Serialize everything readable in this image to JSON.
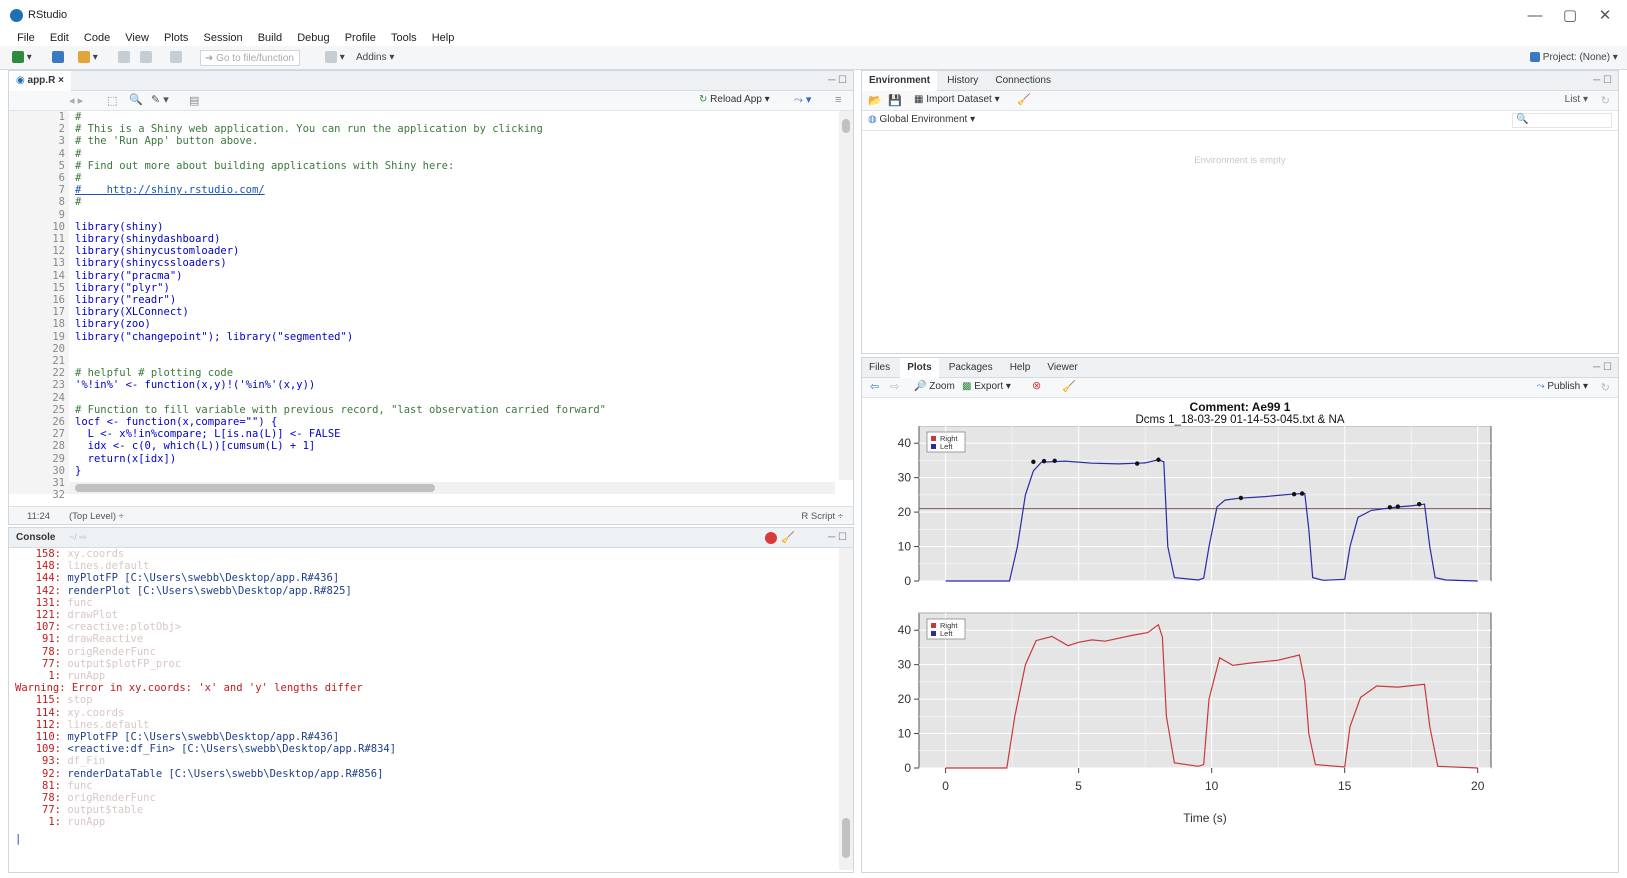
{
  "window": {
    "title": "RStudio",
    "minimize": "—",
    "maximize": "▢",
    "close": "✕"
  },
  "menu": [
    "File",
    "Edit",
    "Code",
    "View",
    "Plots",
    "Session",
    "Build",
    "Debug",
    "Profile",
    "Tools",
    "Help"
  ],
  "toolbar": {
    "goto_placeholder": "Go to file/function",
    "addins": "Addins ▾",
    "project": "Project: (None) ▾"
  },
  "editor": {
    "tab": "app.R",
    "reload_app": "Reload App ▾",
    "lines": [
      {
        "n": "1",
        "text": "#",
        "cls": "cm"
      },
      {
        "n": "2",
        "text": "# This is a Shiny web application. You can run the application by clicking",
        "cls": "cm"
      },
      {
        "n": "3",
        "text": "# the 'Run App' button above.",
        "cls": "cm"
      },
      {
        "n": "4",
        "text": "#",
        "cls": "cm"
      },
      {
        "n": "5",
        "text": "# Find out more about building applications with Shiny here:",
        "cls": "cm"
      },
      {
        "n": "6",
        "text": "#",
        "cls": "cm"
      },
      {
        "n": "7",
        "text": "#    http://shiny.rstudio.com/",
        "cls": "url"
      },
      {
        "n": "8",
        "text": "#",
        "cls": "cm"
      },
      {
        "n": "9",
        "text": "",
        "cls": ""
      },
      {
        "n": "10",
        "text": "library(shiny)",
        "cls": "kw"
      },
      {
        "n": "11",
        "text": "library(shinydashboard)",
        "cls": "kw"
      },
      {
        "n": "12",
        "text": "library(shinycustomloader)",
        "cls": "kw"
      },
      {
        "n": "13",
        "text": "library(shinycssloaders)",
        "cls": "kw"
      },
      {
        "n": "14",
        "text": "library(\"pracma\")",
        "cls": "kw"
      },
      {
        "n": "15",
        "text": "library(\"plyr\")",
        "cls": "kw"
      },
      {
        "n": "16",
        "text": "library(\"readr\")",
        "cls": "kw"
      },
      {
        "n": "17",
        "text": "library(XLConnect)",
        "cls": "kw"
      },
      {
        "n": "18",
        "text": "library(zoo)",
        "cls": "kw"
      },
      {
        "n": "19",
        "text": "library(\"changepoint\"); library(\"segmented\")",
        "cls": "kw"
      },
      {
        "n": "20",
        "text": "",
        "cls": ""
      },
      {
        "n": "21",
        "text": "",
        "cls": ""
      },
      {
        "n": "22",
        "text": "# helpful # plotting code",
        "cls": "cm"
      },
      {
        "n": "23",
        "text": "'%!in%' <- function(x,y)!('%in%'(x,y))",
        "cls": "kw"
      },
      {
        "n": "24",
        "text": "",
        "cls": ""
      },
      {
        "n": "25",
        "text": "# Function to fill variable with previous record, \"last observation carried forward\"",
        "cls": "cm"
      },
      {
        "n": "26",
        "text": "locf <- function(x,compare=\"\") {",
        "cls": "kw"
      },
      {
        "n": "27",
        "text": "  L <- x%!in%compare; L[is.na(L)] <- FALSE",
        "cls": "kw"
      },
      {
        "n": "28",
        "text": "  idx <- c(0, which(L))[cumsum(L) + 1]",
        "cls": "kw"
      },
      {
        "n": "29",
        "text": "  return(x[idx])",
        "cls": "kw"
      },
      {
        "n": "30",
        "text": "}",
        "cls": "kw"
      },
      {
        "n": "31",
        "text": "",
        "cls": ""
      },
      {
        "n": "32",
        "text": "",
        "cls": "kw"
      }
    ],
    "status_pos": "11:24",
    "status_level": "(Top Level) ÷",
    "status_type": "R Script ÷"
  },
  "console": {
    "title": "Console",
    "lines": [
      {
        "n": "158:",
        "t": "xy.coords",
        "faint": true
      },
      {
        "n": "148:",
        "t": "lines.default",
        "faint": true
      },
      {
        "n": "144:",
        "t": "myPlotFP [C:\\Users\\swebb\\Desktop/app.R#436]",
        "faint": false
      },
      {
        "n": "142:",
        "t": "renderPlot [C:\\Users\\swebb\\Desktop/app.R#825]",
        "faint": false
      },
      {
        "n": "131:",
        "t": "func",
        "faint": true
      },
      {
        "n": "121:",
        "t": "drawPlot",
        "faint": true
      },
      {
        "n": "107:",
        "t": "<reactive:plotObj>",
        "faint": true
      },
      {
        "n": "91:",
        "t": "drawReactive",
        "faint": true
      },
      {
        "n": "78:",
        "t": "origRenderFunc",
        "faint": true
      },
      {
        "n": "77:",
        "t": "output$plotFP_proc",
        "faint": true
      },
      {
        "n": "1:",
        "t": "runApp",
        "faint": true
      },
      {
        "n": "",
        "t": "Warning: Error in xy.coords: 'x' and 'y' lengths differ",
        "warn": true
      },
      {
        "n": "115:",
        "t": "stop",
        "faint": true
      },
      {
        "n": "114:",
        "t": "xy.coords",
        "faint": true
      },
      {
        "n": "112:",
        "t": "lines.default",
        "faint": true
      },
      {
        "n": "110:",
        "t": "myPlotFP [C:\\Users\\swebb\\Desktop/app.R#436]",
        "faint": false
      },
      {
        "n": "109:",
        "t": "<reactive:df_Fin> [C:\\Users\\swebb\\Desktop/app.R#834]",
        "faint": false
      },
      {
        "n": "93:",
        "t": "df_Fin",
        "faint": true
      },
      {
        "n": "92:",
        "t": "renderDataTable [C:\\Users\\swebb\\Desktop/app.R#856]",
        "faint": false
      },
      {
        "n": "81:",
        "t": "func",
        "faint": true
      },
      {
        "n": "78:",
        "t": "origRenderFunc",
        "faint": true
      },
      {
        "n": "77:",
        "t": "output$table",
        "faint": true
      },
      {
        "n": "1:",
        "t": "runApp",
        "faint": true
      }
    ]
  },
  "environment": {
    "tabs": [
      "Environment",
      "History",
      "Connections"
    ],
    "import": "Import Dataset ▾",
    "list": "List ▾",
    "global": "Global Environment ▾",
    "empty": "Environment is empty"
  },
  "plots": {
    "tabs": [
      "Files",
      "Plots",
      "Packages",
      "Help",
      "Viewer"
    ],
    "zoom": "Zoom",
    "export": "Export ▾",
    "publish": "Publish ▾",
    "title": "Comment: Ae99 1",
    "subtitle": "Dcms 1_18-03-29 01-14-53-045.txt & NA",
    "xlabel": "Time (s)"
  },
  "chart_data": [
    {
      "type": "line",
      "title": "Comment: Ae99 1",
      "subtitle": "Dcms 1_18-03-29 01-14-53-045.txt & NA",
      "xlabel": "",
      "ylabel": "",
      "xlim": [
        -1,
        20.5
      ],
      "ylim": [
        0,
        45
      ],
      "yticks": [
        0,
        10,
        20,
        30,
        40
      ],
      "legend": [
        "Right",
        "Left"
      ],
      "legend_position": "top-left",
      "grid": true,
      "hline": 21,
      "series": [
        {
          "name": "Left",
          "color": "#2a2aa8",
          "x": [
            0,
            2.4,
            2.7,
            3.0,
            3.3,
            3.6,
            4.5,
            5.5,
            6.5,
            7.5,
            8.0,
            8.2,
            8.35,
            8.6,
            9.5,
            9.7,
            9.9,
            10.2,
            10.5,
            11,
            12,
            13,
            13.5,
            13.65,
            13.8,
            14.2,
            15,
            15.2,
            15.5,
            16,
            17,
            17.5,
            18.0,
            18.2,
            18.4,
            18.8,
            20
          ],
          "y": [
            0,
            0,
            10,
            25,
            32,
            34.5,
            34.8,
            34.2,
            34.0,
            34.3,
            35.2,
            34.6,
            10,
            1.0,
            0.3,
            0.8,
            10,
            21.5,
            23.5,
            24.0,
            24.5,
            25.2,
            25.4,
            15,
            1.0,
            0.2,
            0.5,
            10,
            18.5,
            20.5,
            21.5,
            21.8,
            22.3,
            10,
            1.0,
            0.3,
            0
          ]
        }
      ]
    },
    {
      "type": "line",
      "xlabel": "Time (s)",
      "ylabel": "",
      "xlim": [
        -1,
        20.5
      ],
      "ylim": [
        0,
        45
      ],
      "xticks": [
        0,
        5,
        10,
        15,
        20
      ],
      "yticks": [
        0,
        10,
        20,
        30,
        40
      ],
      "legend": [
        "Right",
        "Left"
      ],
      "legend_position": "top-left",
      "grid": true,
      "series": [
        {
          "name": "Right",
          "color": "#c83a3a",
          "x": [
            0,
            2.3,
            2.6,
            3.0,
            3.4,
            4.0,
            4.6,
            5.0,
            5.5,
            6.0,
            7.0,
            7.6,
            8.0,
            8.15,
            8.3,
            8.6,
            9.5,
            9.7,
            9.9,
            10.3,
            10.8,
            11.5,
            12.5,
            13.3,
            13.5,
            13.65,
            13.9,
            15,
            15.2,
            15.6,
            16.2,
            17,
            18,
            18.2,
            18.5,
            20
          ],
          "y": [
            0,
            0,
            15,
            30,
            37,
            38.2,
            35.5,
            36.5,
            37.2,
            36.8,
            38.5,
            39.3,
            41.6,
            38,
            15,
            1.5,
            0.5,
            1.0,
            20,
            32,
            29.8,
            30.5,
            31.3,
            32.8,
            25,
            10,
            1.0,
            0.3,
            12,
            20.5,
            23.8,
            23.5,
            24.3,
            12,
            0.5,
            0
          ]
        }
      ]
    }
  ]
}
